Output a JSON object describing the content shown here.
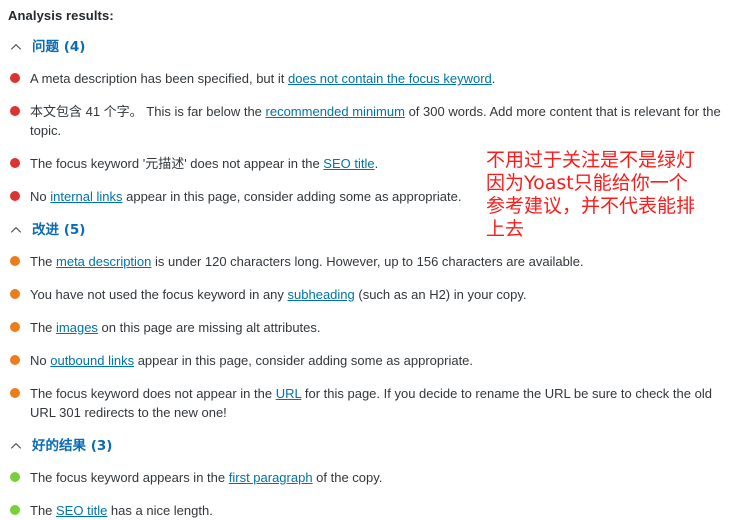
{
  "panel": {
    "title": "Analysis results:"
  },
  "colors": {
    "problem_bullet": "#dc3232",
    "improvement_bullet": "#ee7c1b",
    "good_bullet": "#7ad03a",
    "section_heading": "#0a6cb5",
    "link": "#0073aa",
    "body_text": "#32373c",
    "annotation": "#ff1a1a"
  },
  "sections": [
    {
      "id": "problems",
      "title": "问题 (4)",
      "toggle_icon": "chevron-up-icon",
      "severity": "red",
      "items": [
        {
          "parts": [
            {
              "type": "text",
              "value": "A meta description has been specified, but it "
            },
            {
              "type": "link",
              "value": "does not contain the focus keyword"
            },
            {
              "type": "text",
              "value": "."
            }
          ]
        },
        {
          "parts": [
            {
              "type": "text",
              "value": "本文包含 41 个字。 This is far below the "
            },
            {
              "type": "link",
              "value": "recommended minimum"
            },
            {
              "type": "text",
              "value": " of 300 words. Add more content that is relevant for the topic."
            }
          ]
        },
        {
          "parts": [
            {
              "type": "text",
              "value": "The focus keyword '元描述' does not appear in the "
            },
            {
              "type": "link",
              "value": "SEO title"
            },
            {
              "type": "text",
              "value": "."
            }
          ]
        },
        {
          "parts": [
            {
              "type": "text",
              "value": "No "
            },
            {
              "type": "link",
              "value": "internal links"
            },
            {
              "type": "text",
              "value": " appear in this page, consider adding some as appropriate."
            }
          ]
        }
      ]
    },
    {
      "id": "improvements",
      "title": "改进 (5)",
      "toggle_icon": "chevron-up-icon",
      "severity": "orange",
      "items": [
        {
          "parts": [
            {
              "type": "text",
              "value": "The "
            },
            {
              "type": "link",
              "value": "meta description"
            },
            {
              "type": "text",
              "value": " is under 120 characters long. However, up to 156 characters are available."
            }
          ]
        },
        {
          "parts": [
            {
              "type": "text",
              "value": "You have not used the focus keyword in any "
            },
            {
              "type": "link",
              "value": "subheading"
            },
            {
              "type": "text",
              "value": " (such as an H2) in your copy."
            }
          ]
        },
        {
          "parts": [
            {
              "type": "text",
              "value": "The "
            },
            {
              "type": "link",
              "value": "images"
            },
            {
              "type": "text",
              "value": " on this page are missing alt attributes."
            }
          ]
        },
        {
          "parts": [
            {
              "type": "text",
              "value": "No "
            },
            {
              "type": "link",
              "value": "outbound links"
            },
            {
              "type": "text",
              "value": " appear in this page, consider adding some as appropriate."
            }
          ]
        },
        {
          "parts": [
            {
              "type": "text",
              "value": "The focus keyword does not appear in the "
            },
            {
              "type": "link",
              "value": "URL"
            },
            {
              "type": "text",
              "value": " for this page. If you decide to rename the URL be sure to check the old URL 301 redirects to the new one!"
            }
          ]
        }
      ]
    },
    {
      "id": "good-results",
      "title": "好的结果 (3)",
      "toggle_icon": "chevron-up-icon",
      "severity": "green",
      "items": [
        {
          "parts": [
            {
              "type": "text",
              "value": "The focus keyword appears in the "
            },
            {
              "type": "link",
              "value": "first paragraph"
            },
            {
              "type": "text",
              "value": " of the copy."
            }
          ]
        },
        {
          "parts": [
            {
              "type": "text",
              "value": "The "
            },
            {
              "type": "link",
              "value": "SEO title"
            },
            {
              "type": "text",
              "value": " has a nice length."
            }
          ]
        }
      ]
    }
  ],
  "annotation": {
    "text": "不用过于关注是不是绿灯\n因为Yoast只能给你一个\n参考建议，并不代表能排\n上去"
  }
}
